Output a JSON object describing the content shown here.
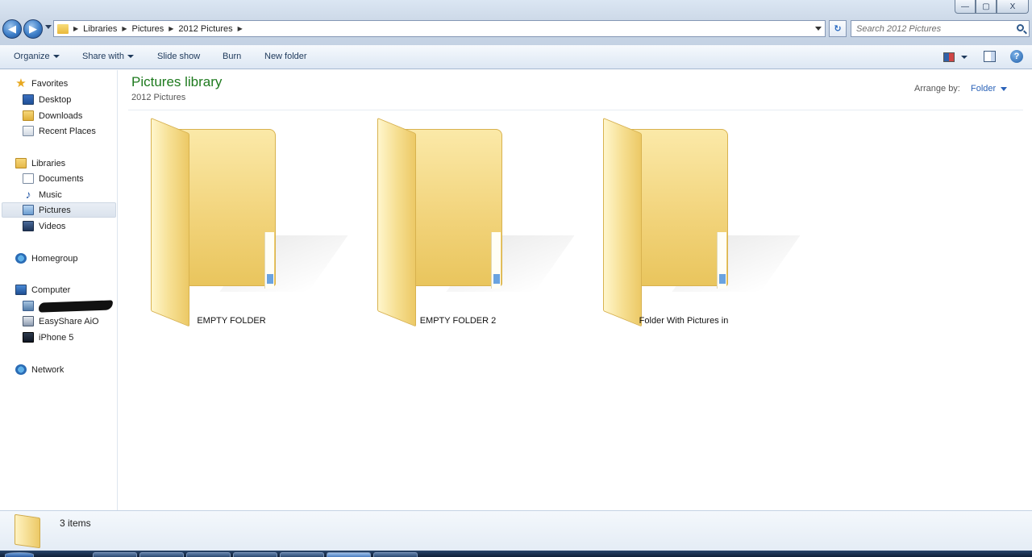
{
  "window": {
    "minimize_glyph": "—",
    "maximize_glyph": "▢",
    "close_glyph": "X"
  },
  "address": {
    "breadcrumbs": [
      "Libraries",
      "Pictures",
      "2012 Pictures"
    ],
    "search_placeholder": "Search 2012 Pictures"
  },
  "toolbar": {
    "organize": "Organize",
    "share_with": "Share with",
    "slide_show": "Slide show",
    "burn": "Burn",
    "new_folder": "New folder",
    "help_glyph": "?"
  },
  "nav": {
    "favorites": "Favorites",
    "desktop": "Desktop",
    "downloads": "Downloads",
    "recent_places": "Recent Places",
    "libraries": "Libraries",
    "documents": "Documents",
    "music": "Music",
    "pictures": "Pictures",
    "videos": "Videos",
    "homegroup": "Homegroup",
    "computer": "Computer",
    "easyshare": "EasyShare AiO",
    "iphone": "iPhone 5",
    "network": "Network"
  },
  "content": {
    "title": "Pictures library",
    "subtitle": "2012 Pictures",
    "arrange_label": "Arrange by:",
    "arrange_value": "Folder",
    "folders": [
      "EMPTY FOLDER",
      "EMPTY FOLDER 2",
      "Folder With Pictures in"
    ]
  },
  "status": {
    "items": "3 items"
  },
  "colors": {
    "library_title": "#1e7a1e",
    "link_blue": "#2a62b8",
    "folder_yellow": "#f1d278"
  }
}
